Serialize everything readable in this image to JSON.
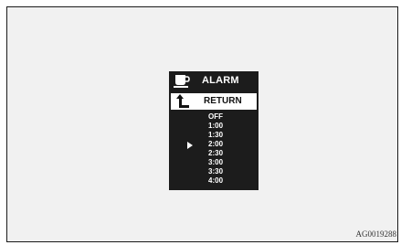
{
  "screen": {
    "title": "ALARM",
    "header_icon": "coffee-cup-icon",
    "return_icon": "return-arrow-icon",
    "return_label": "RETURN",
    "options": [
      "OFF",
      "1:00",
      "1:30",
      "2:00",
      "2:30",
      "3:00",
      "3:30",
      "4:00"
    ],
    "selected_option": "2:00",
    "pointer_icon": "triangle-pointer-icon",
    "background_color": "#1c1c1c",
    "text_color": "#ffffff"
  },
  "figure_code": "AG0019288"
}
